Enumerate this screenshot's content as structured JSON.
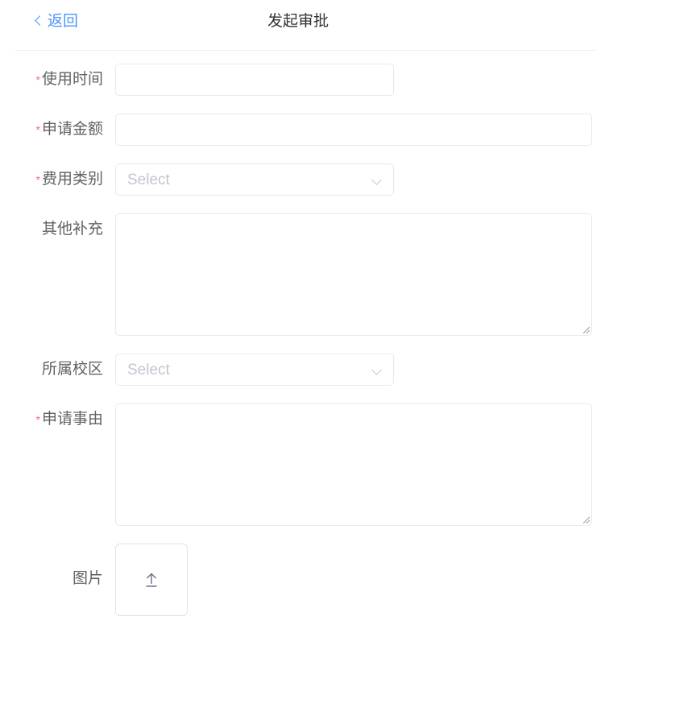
{
  "header": {
    "back_label": "返回",
    "back_icon": "chevron-left-icon",
    "title": "发起审批"
  },
  "colors": {
    "accent_blue": "#4d94ff",
    "required_red": "#f56c6c",
    "label_text": "#606266",
    "title_text": "#303133",
    "border": "#e7e9ef",
    "placeholder": "#c3c6cf",
    "icon_gray": "#c0c4cc"
  },
  "form": {
    "fields": [
      {
        "key": "use_time",
        "label": "使用时间",
        "required": true,
        "type": "date",
        "value": "",
        "placeholder": "",
        "icon": "calendar-icon"
      },
      {
        "key": "apply_amount",
        "label": "申请金额",
        "required": true,
        "type": "text",
        "value": "",
        "placeholder": ""
      },
      {
        "key": "fee_category",
        "label": "费用类别",
        "required": true,
        "type": "select",
        "value": "",
        "placeholder": "Select",
        "icon": "chevron-down-icon"
      },
      {
        "key": "other_notes",
        "label": "其他补充",
        "required": false,
        "type": "textarea",
        "value": "",
        "placeholder": ""
      },
      {
        "key": "campus",
        "label": "所属校区",
        "required": false,
        "type": "select",
        "value": "",
        "placeholder": "Select",
        "icon": "chevron-down-icon"
      },
      {
        "key": "apply_reason",
        "label": "申请事由",
        "required": true,
        "type": "textarea",
        "value": "",
        "placeholder": ""
      },
      {
        "key": "images",
        "label": "图片",
        "required": false,
        "type": "upload",
        "icon": "upload-arrow-icon"
      }
    ],
    "required_marker": "*"
  }
}
